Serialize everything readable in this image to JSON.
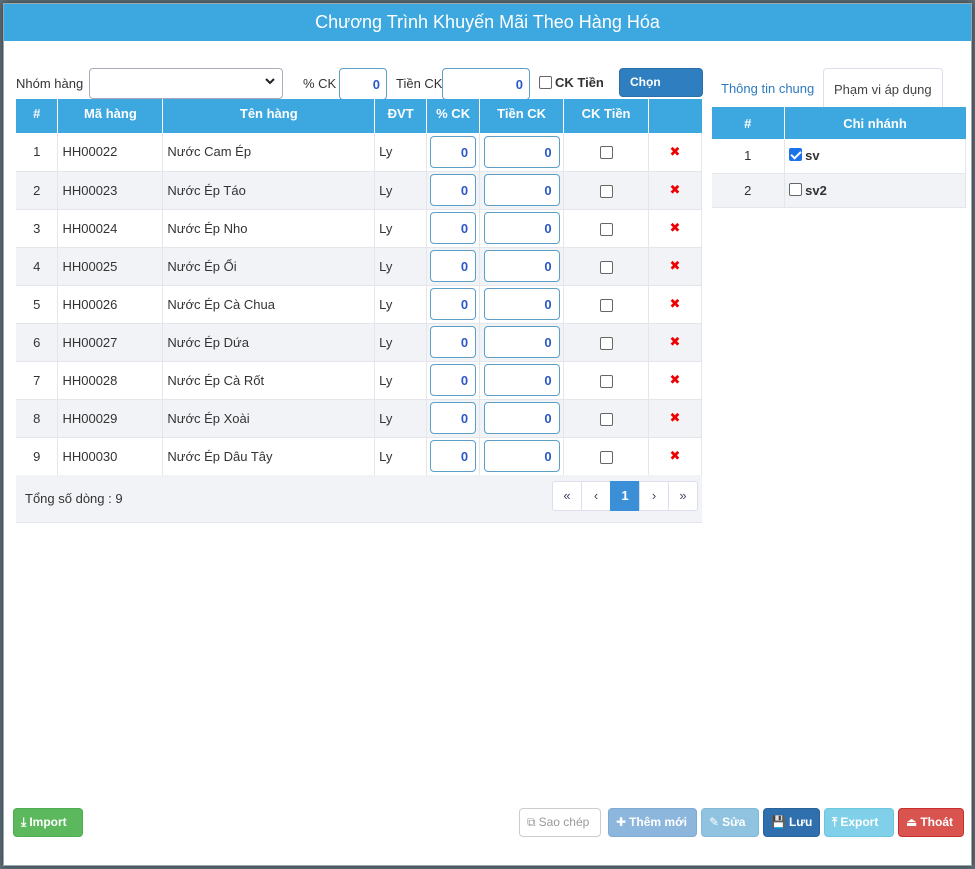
{
  "window": {
    "title": "Chương Trình Khuyến Mãi Theo Hàng Hóa"
  },
  "filter": {
    "group_label": "Nhóm hàng",
    "group_value": "",
    "pct_label": "% CK",
    "pct_value": "0",
    "amount_label": "Tiền CK",
    "amount_value": "0",
    "ck_money_label": "CK Tiền",
    "quick_pick_label": "Chọn nhanh"
  },
  "table": {
    "headers": [
      "#",
      "Mã hàng",
      "Tên hàng",
      "ĐVT",
      "% CK",
      "Tiền CK",
      "CK Tiền",
      ""
    ],
    "rows": [
      {
        "no": "1",
        "code": "HH00022",
        "name": "Nước Cam Ép",
        "unit": "Ly",
        "pct": "0",
        "amount": "0"
      },
      {
        "no": "2",
        "code": "HH00023",
        "name": "Nước Ép Táo",
        "unit": "Ly",
        "pct": "0",
        "amount": "0"
      },
      {
        "no": "3",
        "code": "HH00024",
        "name": "Nước Ép Nho",
        "unit": "Ly",
        "pct": "0",
        "amount": "0"
      },
      {
        "no": "4",
        "code": "HH00025",
        "name": "Nước Ép Ổi",
        "unit": "Ly",
        "pct": "0",
        "amount": "0"
      },
      {
        "no": "5",
        "code": "HH00026",
        "name": "Nước Ép Cà Chua",
        "unit": "Ly",
        "pct": "0",
        "amount": "0"
      },
      {
        "no": "6",
        "code": "HH00027",
        "name": "Nước Ép Dứa",
        "unit": "Ly",
        "pct": "0",
        "amount": "0"
      },
      {
        "no": "7",
        "code": "HH00028",
        "name": "Nước Ép Cà Rốt",
        "unit": "Ly",
        "pct": "0",
        "amount": "0"
      },
      {
        "no": "8",
        "code": "HH00029",
        "name": "Nước Ép Xoài",
        "unit": "Ly",
        "pct": "0",
        "amount": "0"
      },
      {
        "no": "9",
        "code": "HH00030",
        "name": "Nước Ép Dâu Tây",
        "unit": "Ly",
        "pct": "0",
        "amount": "0"
      }
    ],
    "total_text": "Tổng số dòng : 9",
    "pager": [
      "«",
      "‹",
      "1",
      "›",
      "»"
    ]
  },
  "tabs": {
    "general": "Thông tin chung",
    "scope": "Phạm vi áp dụng"
  },
  "branch_table": {
    "headers": [
      "#",
      "Chi nhánh"
    ],
    "rows": [
      {
        "no": "1",
        "name": "sv",
        "checked": true
      },
      {
        "no": "2",
        "name": "sv2",
        "checked": false
      }
    ]
  },
  "buttons": {
    "import": "Import",
    "copy": "Sao chép",
    "add": "Thêm mới",
    "edit": "Sửa",
    "save": "Lưu",
    "export": "Export",
    "exit": "Thoát"
  },
  "colors": {
    "header_blue": "#3da7e0",
    "import_green": "#5cb85c",
    "save_blue": "#2f6fad",
    "exit_red": "#d9534f",
    "delete_red": "#ee0000"
  }
}
